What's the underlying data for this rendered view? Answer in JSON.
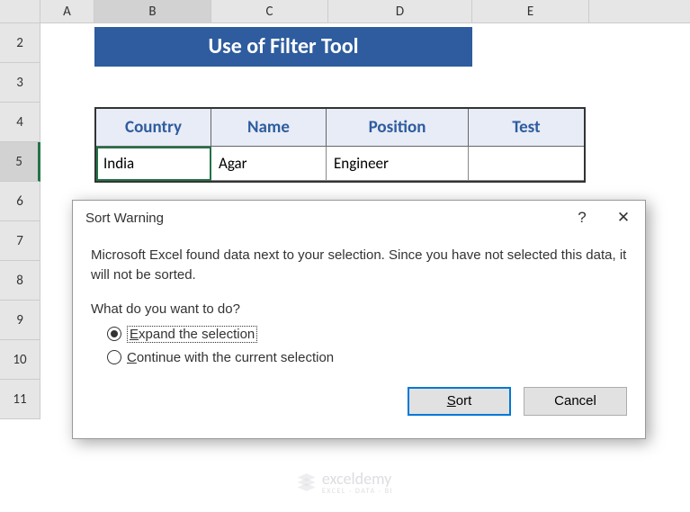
{
  "columns": [
    "A",
    "B",
    "C",
    "D",
    "E"
  ],
  "rows": [
    "2",
    "3",
    "4",
    "5",
    "6",
    "7",
    "8",
    "9",
    "10",
    "11"
  ],
  "title_banner": "Use of  Filter Tool",
  "table": {
    "headers": [
      "Country",
      "Name",
      "Position",
      "Test"
    ],
    "data_row": [
      "India",
      "Agar",
      "Engineer",
      ""
    ]
  },
  "dialog": {
    "title": "Sort Warning",
    "help_symbol": "?",
    "close_symbol": "✕",
    "message": "Microsoft Excel found data next to your selection.  Since you have not selected this data, it will not be sorted.",
    "question": "What do you want to do?",
    "options": {
      "expand": "Expand the selection",
      "continue": "Continue with the current selection"
    },
    "selected_option": "expand",
    "buttons": {
      "sort": "Sort",
      "cancel": "Cancel"
    }
  },
  "watermark": {
    "name": "exceldemy",
    "sub": "EXCEL · DATA · BI"
  }
}
